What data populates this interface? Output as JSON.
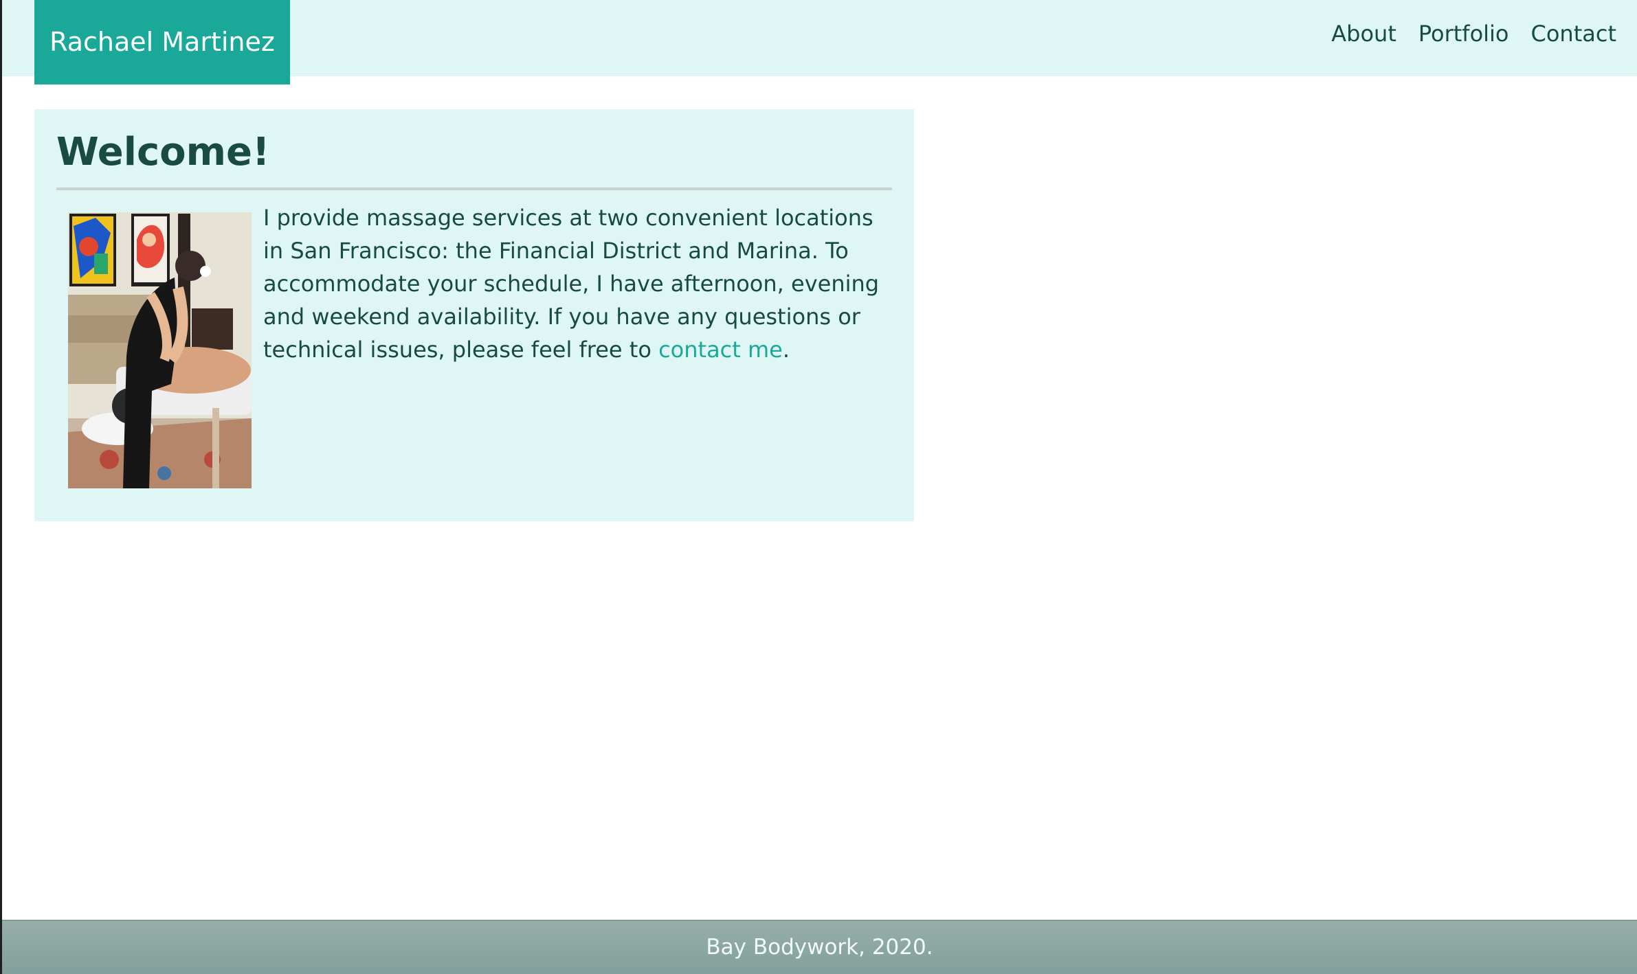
{
  "header": {
    "brand": "Rachael Martinez",
    "nav": [
      {
        "label": "About"
      },
      {
        "label": "Portfolio"
      },
      {
        "label": "Contact"
      }
    ]
  },
  "welcome": {
    "title": "Welcome!",
    "text_before_link": "I provide massage services at two convenient locations in San Francisco: the Financial District and Marina. To accommodate your schedule, I have afternoon, evening and weekend availability. If you have any questions or technical issues, please feel free to ",
    "link_text": "contact me",
    "text_after_link": ".",
    "photo_alt": ""
  },
  "footer": {
    "text": "Bay Bodywork, 2020."
  },
  "colors": {
    "accent": "#1aa899",
    "panel": "#dff7f4",
    "text": "#174a44",
    "footer": "#8ba7a3"
  }
}
